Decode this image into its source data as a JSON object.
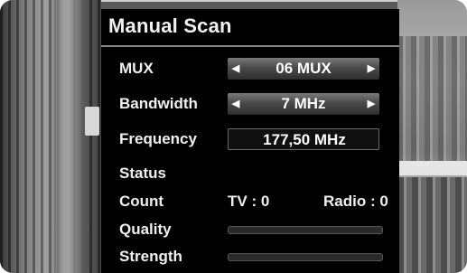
{
  "title": "Manual Scan",
  "mux": {
    "label": "MUX",
    "value": "06 MUX",
    "left_arrow": "◀",
    "right_arrow": "▶"
  },
  "bandwidth": {
    "label": "Bandwidth",
    "value": "7 MHz",
    "left_arrow": "◀",
    "right_arrow": "▶"
  },
  "frequency": {
    "label": "Frequency",
    "value": "177,50 MHz"
  },
  "status": {
    "label": "Status"
  },
  "count": {
    "label": "Count",
    "tv": "TV : 0",
    "radio": "Radio : 0"
  },
  "quality": {
    "label": "Quality",
    "level": 0
  },
  "strength": {
    "label": "Strength",
    "level": 0
  }
}
